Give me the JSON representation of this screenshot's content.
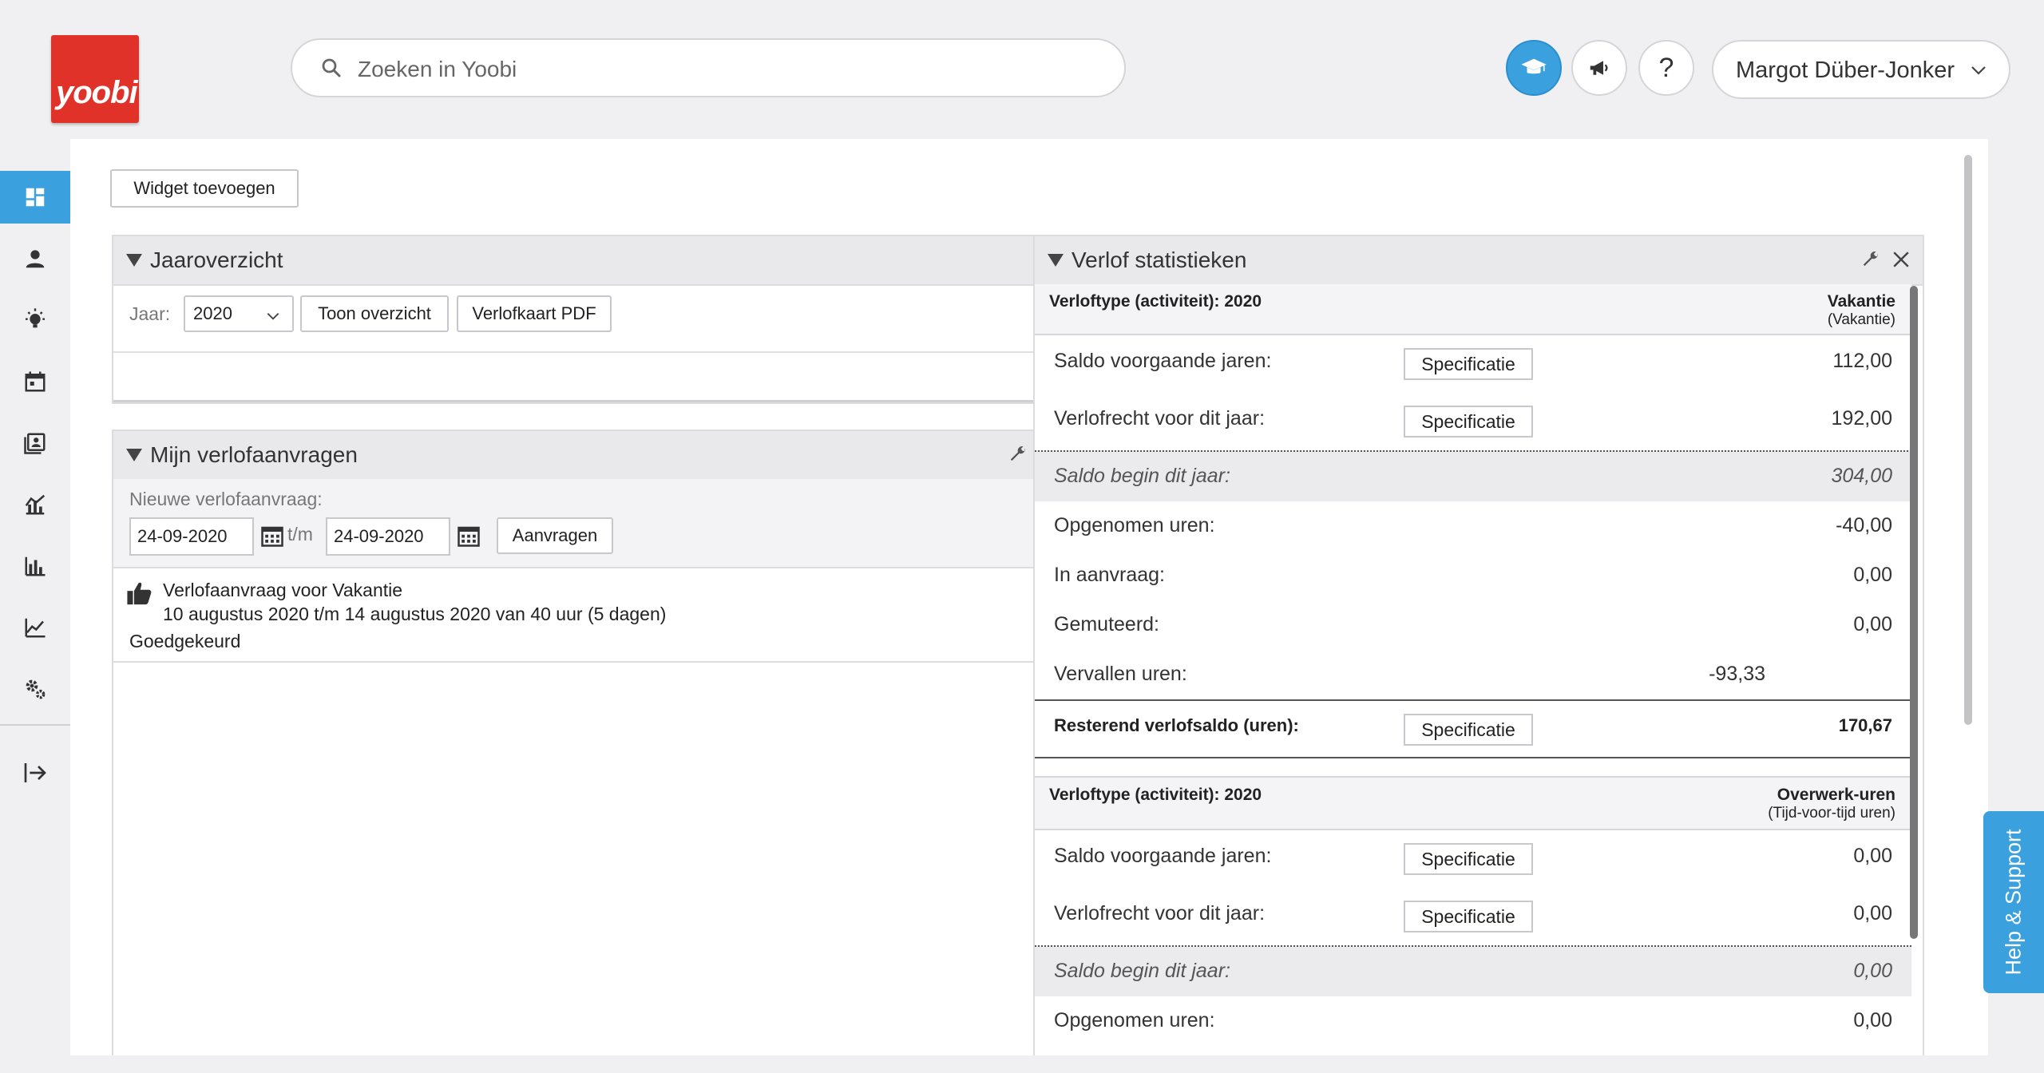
{
  "brand": {
    "logo_text": "yoobi",
    "color": "#e03228"
  },
  "search": {
    "placeholder": "Zoeken in Yoobi"
  },
  "header": {
    "help_label": "?",
    "user_name": "Margot Düber-Jonker"
  },
  "sidebar": {
    "items": [
      "dashboard-icon",
      "user-icon",
      "lightbulb-icon",
      "calendar-icon",
      "contacts-icon",
      "stats-icon",
      "bar-chart-icon",
      "line-chart-icon",
      "settings-icon",
      "logout-icon"
    ],
    "accent": "#3aa0de"
  },
  "toolbar": {
    "widget_add_label": "Widget toevoegen"
  },
  "jaaroverzicht": {
    "title": "Jaaroverzicht",
    "year_label": "Jaar:",
    "year_value": "2020",
    "toon_label": "Toon overzicht",
    "pdf_label": "Verlofkaart PDF"
  },
  "mijn": {
    "title": "Mijn verlofaanvragen",
    "new_label": "Nieuwe verlofaanvraag:",
    "date_from": "24-09-2020",
    "tm": "t/m",
    "date_to": "24-09-2020",
    "aanvragen_label": "Aanvragen",
    "requests": [
      {
        "title": "Verlofaanvraag voor Vakantie",
        "detail": "10 augustus 2020 t/m 14 augustus 2020 van 40 uur (5 dagen)",
        "status": "Goedgekeurd"
      }
    ]
  },
  "stats": {
    "title": "Verlof statistieken",
    "spec_label": "Specificatie",
    "sections": [
      {
        "type_label": "Verloftype (activiteit): 2020",
        "name": "Vakantie",
        "sub": "(Vakantie)",
        "saldo_voorgaand_label": "Saldo voorgaande jaren:",
        "saldo_voorgaand": "112,00",
        "verlofrecht_label": "Verlofrecht voor dit jaar:",
        "verlofrecht": "192,00",
        "saldo_begin_label": "Saldo begin dit jaar:",
        "saldo_begin": "304,00",
        "opgenomen_label": "Opgenomen uren:",
        "opgenomen": "-40,00",
        "aanvraag_label": "In aanvraag:",
        "aanvraag": "0,00",
        "gemuteerd_label": "Gemuteerd:",
        "gemuteerd": "0,00",
        "vervallen_label": "Vervallen uren:",
        "vervallen": "-93,33",
        "resterend_label": "Resterend verlofsaldo (uren):",
        "resterend": "170,67"
      },
      {
        "type_label": "Verloftype (activiteit): 2020",
        "name": "Overwerk-uren",
        "sub": "(Tijd-voor-tijd uren)",
        "saldo_voorgaand_label": "Saldo voorgaande jaren:",
        "saldo_voorgaand": "0,00",
        "verlofrecht_label": "Verlofrecht voor dit jaar:",
        "verlofrecht": "0,00",
        "saldo_begin_label": "Saldo begin dit jaar:",
        "saldo_begin": "0,00",
        "opgenomen_label": "Opgenomen uren:",
        "opgenomen": "0,00"
      }
    ]
  },
  "help_tab": {
    "label": "Help & Support"
  }
}
